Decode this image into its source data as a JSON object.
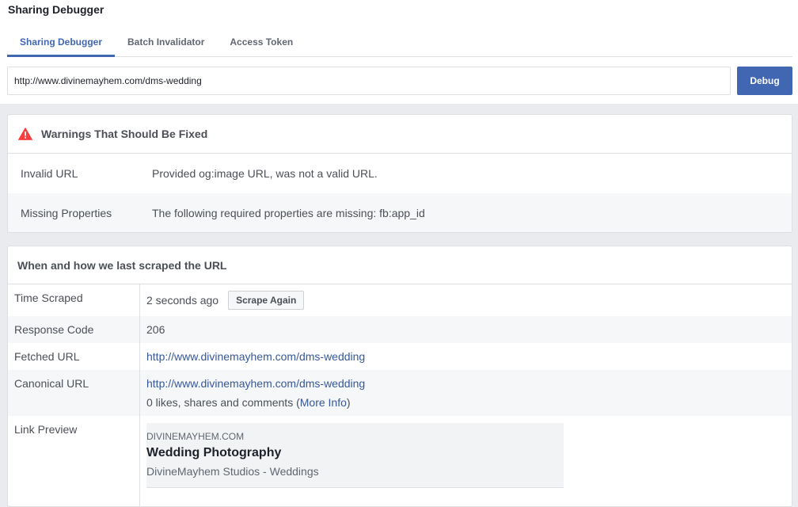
{
  "app_title": "Sharing Debugger",
  "tabs": [
    {
      "label": "Sharing Debugger",
      "active": true
    },
    {
      "label": "Batch Invalidator",
      "active": false
    },
    {
      "label": "Access Token",
      "active": false
    }
  ],
  "url_bar": {
    "value": "http://www.divinemayhem.com/dms-wedding",
    "debug_label": "Debug"
  },
  "warnings": {
    "title": "Warnings That Should Be Fixed",
    "rows": [
      {
        "key": "Invalid URL",
        "value": "Provided og:image URL, was not a valid URL."
      },
      {
        "key": "Missing Properties",
        "value": "The following required properties are missing: fb:app_id"
      }
    ]
  },
  "scrape": {
    "title": "When and how we last scraped the URL",
    "time_scraped": {
      "key": "Time Scraped",
      "value": "2 seconds ago",
      "button": "Scrape Again"
    },
    "response_code": {
      "key": "Response Code",
      "value": "206"
    },
    "fetched_url": {
      "key": "Fetched URL",
      "value": "http://www.divinemayhem.com/dms-wedding"
    },
    "canonical_url": {
      "key": "Canonical URL",
      "value": "http://www.divinemayhem.com/dms-wedding",
      "likes_text": "0 likes, shares and comments (",
      "more_info": "More Info",
      "close_paren": ")"
    },
    "link_preview": {
      "key": "Link Preview",
      "domain": "DIVINEMAYHEM.COM",
      "title": "Wedding Photography",
      "description": "DivineMayhem Studios - Weddings"
    }
  },
  "colors": {
    "accent": "#4267b2",
    "warning_red": "#fa3e3e",
    "link": "#365899"
  }
}
